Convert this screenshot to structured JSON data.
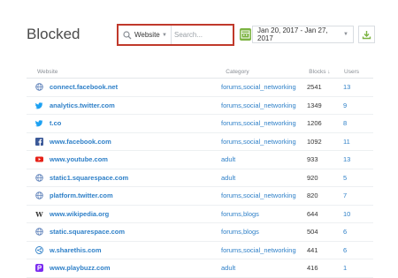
{
  "header": {
    "title": "Blocked",
    "search_type": "Website",
    "search_placeholder": "Search...",
    "date_range": "Jan 20, 2017 - Jan 27, 2017"
  },
  "table": {
    "columns": {
      "website": "Website",
      "category": "Category",
      "blocks": "Blocks ↓",
      "users": "Users"
    },
    "rows": [
      {
        "icon": "globe-icon",
        "site": "connect.facebook.net",
        "category": "forums,social_networking",
        "blocks": "2541",
        "users": "13"
      },
      {
        "icon": "twitter-icon",
        "site": "analytics.twitter.com",
        "category": "forums,social_networking",
        "blocks": "1349",
        "users": "9"
      },
      {
        "icon": "twitter-icon",
        "site": "t.co",
        "category": "forums,social_networking",
        "blocks": "1206",
        "users": "8"
      },
      {
        "icon": "facebook-icon",
        "site": "www.facebook.com",
        "category": "forums,social_networking",
        "blocks": "1092",
        "users": "11"
      },
      {
        "icon": "youtube-icon",
        "site": "www.youtube.com",
        "category": "adult",
        "blocks": "933",
        "users": "13"
      },
      {
        "icon": "globe-icon",
        "site": "static1.squarespace.com",
        "category": "adult",
        "blocks": "920",
        "users": "5"
      },
      {
        "icon": "globe-icon",
        "site": "platform.twitter.com",
        "category": "forums,social_networking",
        "blocks": "820",
        "users": "7"
      },
      {
        "icon": "wikipedia-icon",
        "site": "www.wikipedia.org",
        "category": "forums,blogs",
        "blocks": "644",
        "users": "10"
      },
      {
        "icon": "globe-icon",
        "site": "static.squarespace.com",
        "category": "forums,blogs",
        "blocks": "504",
        "users": "6"
      },
      {
        "icon": "sharethis-icon",
        "site": "w.sharethis.com",
        "category": "forums,social_networking",
        "blocks": "441",
        "users": "6"
      },
      {
        "icon": "playbuzz-icon",
        "site": "www.playbuzz.com",
        "category": "adult",
        "blocks": "416",
        "users": "1"
      }
    ]
  },
  "colors": {
    "link": "#2f80c8",
    "highlight_border": "#c0392b",
    "accent_green": "#7cb342",
    "youtube": "#e62117",
    "twitter": "#1da1f2",
    "facebook": "#3b5998",
    "playbuzz": "#7b2cf0"
  }
}
